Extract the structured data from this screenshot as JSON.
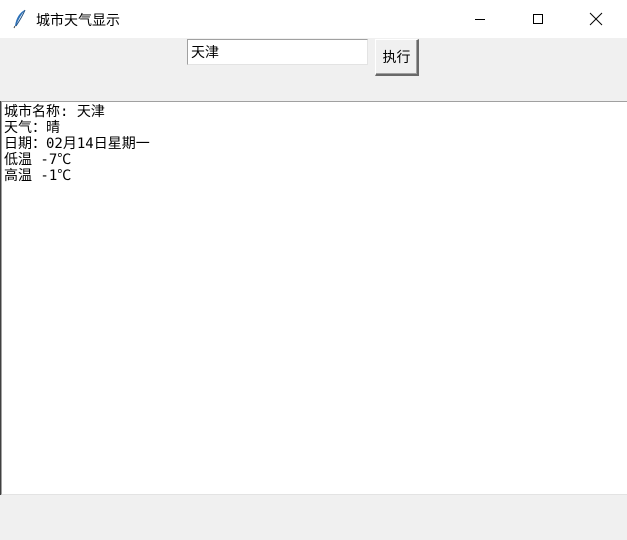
{
  "window": {
    "title": "城市天气显示",
    "app_icon": "feather-icon",
    "controls": {
      "minimize_icon": "minimize-icon",
      "maximize_icon": "maximize-icon",
      "close_icon": "close-icon"
    }
  },
  "toolbar": {
    "city_input_value": "天津",
    "execute_label": "执行"
  },
  "output": {
    "lines": [
      "城市名称: 天津",
      "天气：晴",
      "日期：02月14日星期一",
      "低温 -7℃",
      "高温 -1℃"
    ]
  }
}
